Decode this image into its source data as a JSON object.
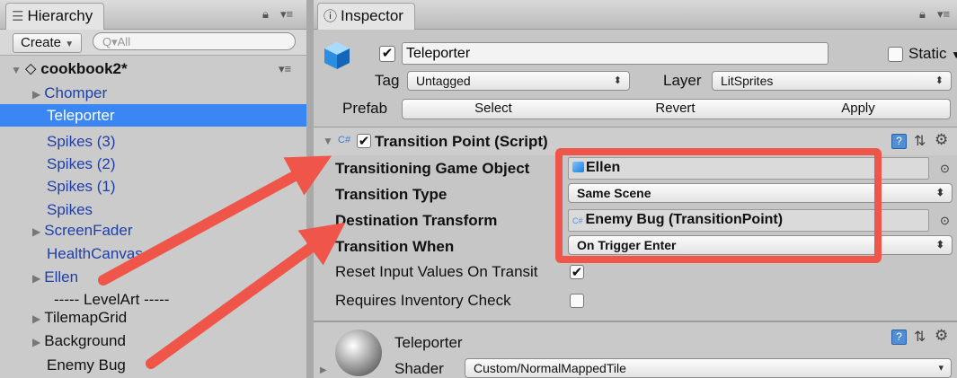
{
  "hierarchy": {
    "tab_title": "Hierarchy",
    "create_label": "Create",
    "search_placeholder": "All",
    "scene_name": "cookbook2*",
    "items": [
      {
        "label": "Chomper",
        "arrow": true
      },
      {
        "label": "Teleporter",
        "arrow": false,
        "selected": true
      },
      {
        "label": "Spikes (3)",
        "arrow": false
      },
      {
        "label": "Spikes (2)",
        "arrow": false
      },
      {
        "label": "Spikes (1)",
        "arrow": false
      },
      {
        "label": "Spikes",
        "arrow": false
      },
      {
        "label": "ScreenFader",
        "arrow": true
      },
      {
        "label": "HealthCanvas",
        "arrow": false
      },
      {
        "label": "Ellen",
        "arrow": true
      },
      {
        "label": "----- LevelArt -----",
        "arrow": false
      },
      {
        "label": "TilemapGrid",
        "arrow": true
      },
      {
        "label": "Background",
        "arrow": true
      },
      {
        "label": "Enemy Bug",
        "arrow": false
      }
    ]
  },
  "inspector": {
    "tab_title": "Inspector",
    "object_name": "Teleporter",
    "static_label": "Static",
    "tag_label": "Tag",
    "tag_value": "Untagged",
    "layer_label": "Layer",
    "layer_value": "LitSprites",
    "prefab_label": "Prefab",
    "prefab_buttons": {
      "select": "Select",
      "revert": "Revert",
      "apply": "Apply"
    },
    "component": {
      "title": "Transition Point (Script)",
      "fields": {
        "transitioning_game_object": {
          "label": "Transitioning Game Object",
          "value": "Ellen"
        },
        "transition_type": {
          "label": "Transition Type",
          "value": "Same Scene"
        },
        "destination_transform": {
          "label": "Destination Transform",
          "value": "Enemy Bug (TransitionPoint)"
        },
        "transition_when": {
          "label": "Transition When",
          "value": "On Trigger Enter"
        },
        "reset_input": {
          "label": "Reset Input Values On Transit",
          "checked": true
        },
        "requires_inventory": {
          "label": "Requires Inventory Check",
          "checked": false
        }
      }
    },
    "material": {
      "name": "Teleporter",
      "shader_label": "Shader",
      "shader_value": "Custom/NormalMappedTile"
    }
  },
  "colors": {
    "selection": "#3a86f2",
    "annotation": "#ef5548",
    "link_text": "#1f3fa8"
  }
}
